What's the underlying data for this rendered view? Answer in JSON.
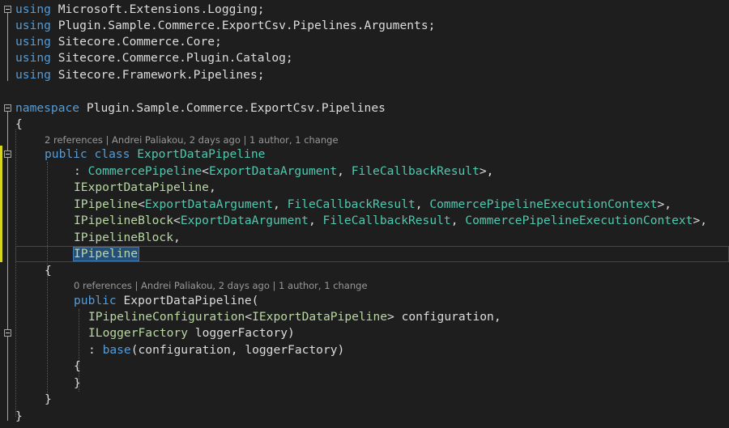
{
  "usings": [
    {
      "kw": "using",
      "ns": "Microsoft.Extensions.Logging;"
    },
    {
      "kw": "using",
      "ns": "Plugin.Sample.Commerce.ExportCsv.Pipelines.Arguments;"
    },
    {
      "kw": "using",
      "ns": "Sitecore.Commerce.Core;"
    },
    {
      "kw": "using",
      "ns": "Sitecore.Commerce.Plugin.Catalog;"
    },
    {
      "kw": "using",
      "ns": "Sitecore.Framework.Pipelines;"
    }
  ],
  "namespace": {
    "kw": "namespace",
    "name": "Plugin.Sample.Commerce.ExportCsv.Pipelines"
  },
  "brace_open": "{",
  "brace_close": "}",
  "class_lens": "2 references | Andrei Paliakou, 2 days ago | 1 author, 1 change",
  "class_decl": {
    "mod": "public",
    "kw": "class",
    "name": "ExportDataPipeline"
  },
  "base_lines": {
    "l1": {
      "prefix": ": ",
      "t1": "CommercePipeline",
      "lt": "<",
      "a1": "ExportDataArgument",
      ", ": ", ",
      "a2": "FileCallbackResult",
      "end": ">,"
    },
    "l2": {
      "t": "IExportDataPipeline",
      "end": ","
    },
    "l3": {
      "t": "IPipeline",
      "lt": "<",
      "a1": "ExportDataArgument",
      "sep1": ", ",
      "a2": "FileCallbackResult",
      "sep2": ", ",
      "a3": "CommercePipelineExecutionContext",
      "end": ">,"
    },
    "l4": {
      "t": "IPipelineBlock",
      "lt": "<",
      "a1": "ExportDataArgument",
      "sep1": ", ",
      "a2": "FileCallbackResult",
      "sep2": ", ",
      "a3": "CommercePipelineExecutionContext",
      "end": ">,"
    },
    "l5": {
      "t": "IPipelineBlock",
      "end": ","
    },
    "l6": {
      "t": "IPipeline"
    }
  },
  "ctor_lens": "0 references | Andrei Paliakou, 2 days ago | 1 author, 1 change",
  "ctor": {
    "mod": "public",
    "name": "ExportDataPipeline",
    "paren": "(",
    "p1_type": "IPipelineConfiguration",
    "p1_lt": "<",
    "p1_arg": "IExportDataPipeline",
    "p1_rest": "> configuration,",
    "p2_type": "ILoggerFactory",
    "p2_rest": " loggerFactory)",
    "base_prefix": ": ",
    "base_kw": "base",
    "base_rest": "(configuration, loggerFactory)"
  }
}
